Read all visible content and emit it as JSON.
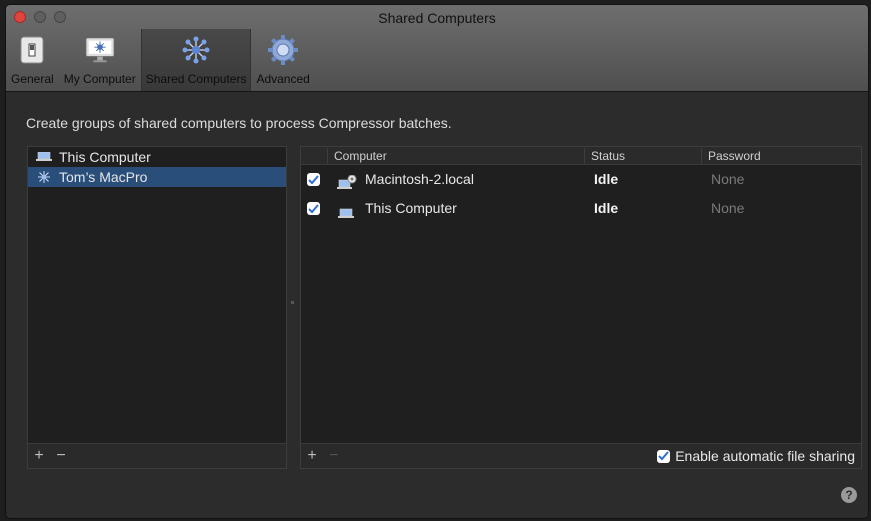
{
  "window": {
    "title": "Shared Computers"
  },
  "toolbar": {
    "tabs": [
      {
        "label": "General",
        "icon": "switch-icon"
      },
      {
        "label": "My Computer",
        "icon": "monitor-icon"
      },
      {
        "label": "Shared Computers",
        "icon": "cluster-icon"
      },
      {
        "label": "Advanced",
        "icon": "gear-icon"
      }
    ],
    "active_tab": "Shared Computers"
  },
  "description": "Create groups of shared computers to process Compressor batches.",
  "groups": {
    "items": [
      {
        "label": "This Computer",
        "icon": "laptop-icon",
        "selected": false
      },
      {
        "label": "Tom’s MacPro",
        "icon": "cluster-icon",
        "selected": true
      }
    ],
    "add_label": "+",
    "remove_label": "−"
  },
  "computers": {
    "columns": [
      "Computer",
      "Status",
      "Password"
    ],
    "rows": [
      {
        "checked": true,
        "name": "Macintosh-2.local",
        "icon": "network-laptop-icon",
        "status": "Idle",
        "password": "None"
      },
      {
        "checked": true,
        "name": "This Computer",
        "icon": "laptop-icon",
        "status": "Idle",
        "password": "None"
      }
    ],
    "add_label": "+",
    "remove_label": "−",
    "auto_share_label": "Enable automatic file sharing",
    "auto_share_checked": true
  },
  "help_label": "?",
  "colors": {
    "accent": "#2a4e7a",
    "check": "#2f6fd1",
    "close": "#e0443e"
  }
}
